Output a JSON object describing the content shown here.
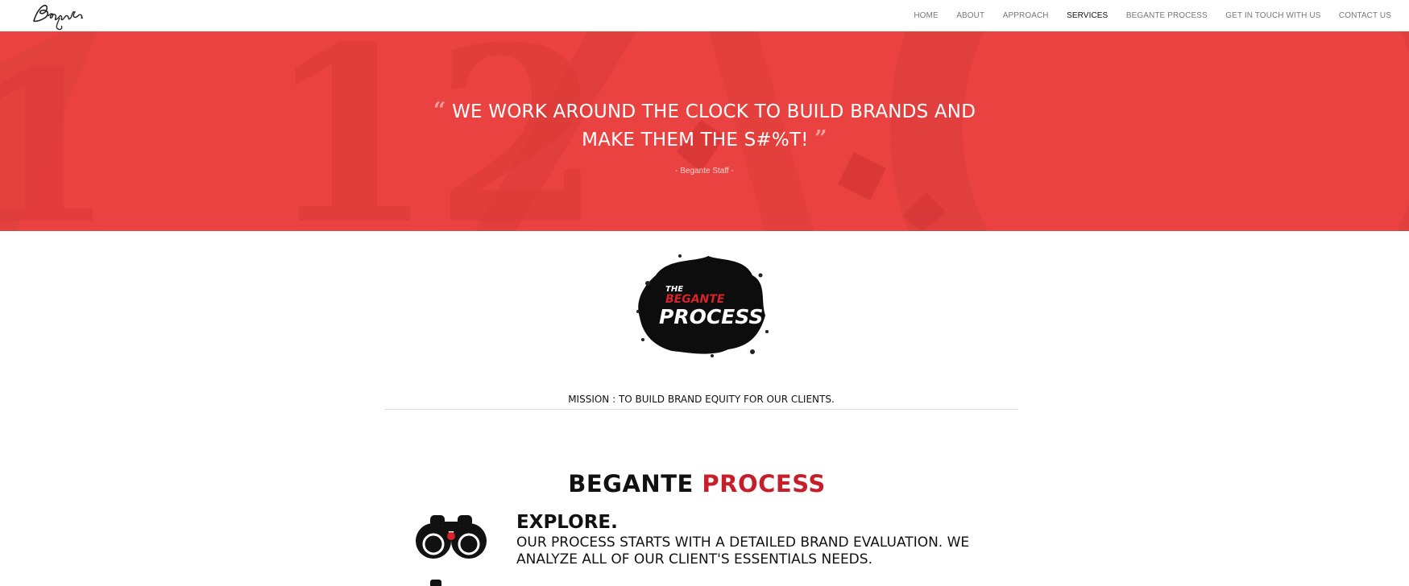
{
  "header": {
    "logo_text": "Begante",
    "nav": [
      {
        "label": "HOME",
        "active": false
      },
      {
        "label": "ABOUT",
        "active": false
      },
      {
        "label": "APPROACH",
        "active": false
      },
      {
        "label": "SERVICES",
        "active": true
      },
      {
        "label": "BEGANTE PROCESS",
        "active": false
      },
      {
        "label": "GET IN TOUCH WITH US",
        "active": false
      },
      {
        "label": "CONTACT US",
        "active": false
      }
    ]
  },
  "hero": {
    "quote_line1": "WE WORK AROUND THE CLOCK TO BUILD BRANDS AND",
    "quote_line2": "MAKE THEM THE S#%T!",
    "open_quote": "“",
    "close_quote": "”",
    "attribution": "- Begante Staff -",
    "background_color": "#e94240"
  },
  "badge": {
    "line1": "THE",
    "line2": "BEGANTE",
    "line3": "PROCESS"
  },
  "mission": "MISSION : TO BUILD BRAND EQUITY FOR OUR CLIENTS.",
  "process": {
    "title_black": "BEGANTE",
    "title_red": "PROCESS",
    "accent_color": "#c71f2a",
    "steps": [
      {
        "icon": "binoculars-icon",
        "heading": "EXPLORE.",
        "text": "OUR PROCESS STARTS WITH A DETAILED BRAND EVALUATION. WE ANALYZE ALL OF OUR CLIENT'S ESSENTIALS NEEDS."
      }
    ]
  }
}
